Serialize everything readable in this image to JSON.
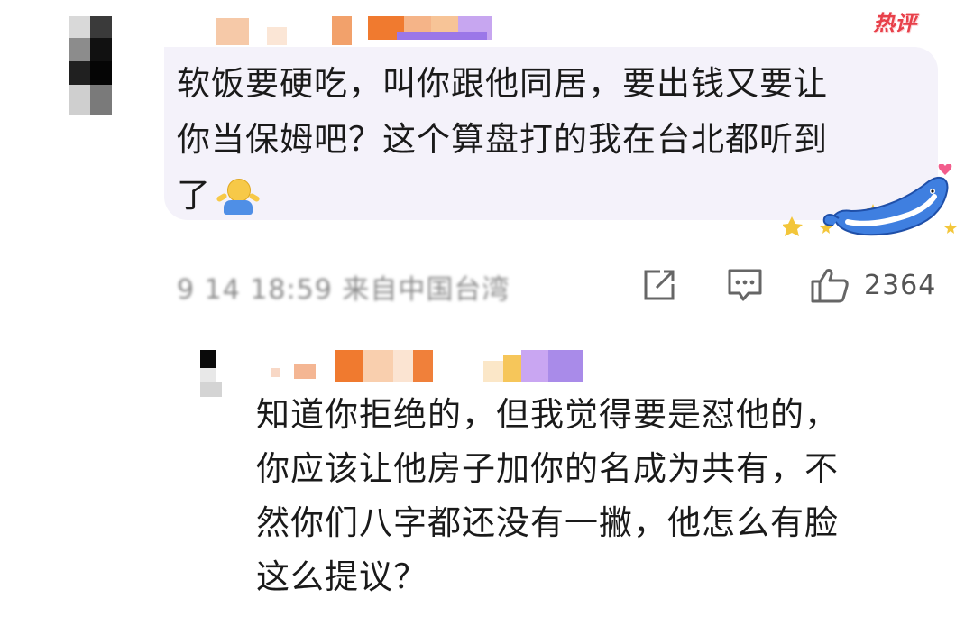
{
  "comment": {
    "hot_badge": "热评",
    "text_lines": [
      "软饭要硬吃，叫你跟他同居，要出钱又要让",
      "你当保姆吧？这个算盘打的我在台北都听到",
      "了"
    ],
    "emoji_icon": "shrug-emoji-icon",
    "decoration_icon": "whale-stars-icon",
    "meta": {
      "time_text": "9 14 18:59",
      "location_text": "来自中国台湾"
    },
    "actions": {
      "share_icon": "share-icon",
      "comment_icon": "comment-icon",
      "like_icon": "thumbs-up-icon",
      "like_count": "2364"
    }
  },
  "reply": {
    "text_lines": [
      "知道你拒绝的，但我觉得要是怼他的，",
      "你应该让他房子加你的名成为共有，不",
      "然你们八字都还没有一撇，他怎么有脸",
      "这么提议？"
    ]
  },
  "colors": {
    "bubble": "#f4f2fa",
    "hot_badge": "#e8404a",
    "meta_gray": "#8a8a8a",
    "whale_blue": "#3f7fe0"
  }
}
